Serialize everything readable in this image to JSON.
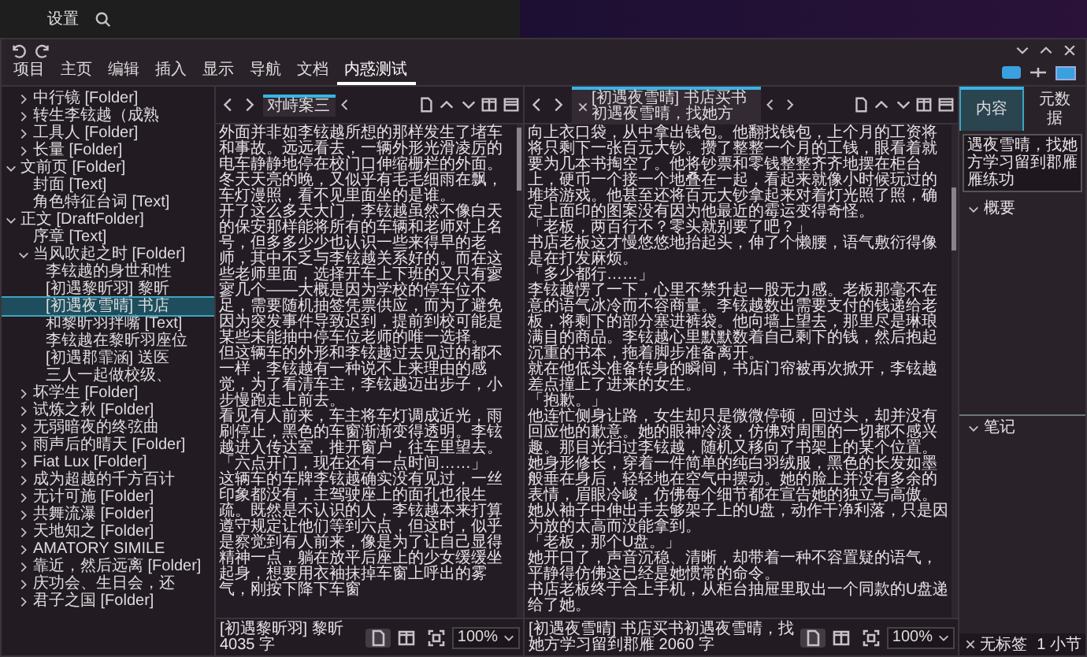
{
  "background_window": {
    "title": "设置"
  },
  "menu_tabs": [
    {
      "label": "项目",
      "selected": false
    },
    {
      "label": "主页",
      "selected": false
    },
    {
      "label": "编辑",
      "selected": false
    },
    {
      "label": "插入",
      "selected": false
    },
    {
      "label": "显示",
      "selected": false
    },
    {
      "label": "导航",
      "selected": false
    },
    {
      "label": "文档",
      "selected": false
    },
    {
      "label": "内惑测试",
      "selected": true
    }
  ],
  "binder": {
    "scrolled_parent_children": [
      {
        "label": "中行镜 [Folder]",
        "selected": false,
        "expanded": false
      },
      {
        "label": "转生李铉越（成熟",
        "selected": false,
        "expanded": false
      },
      {
        "label": "工具人 [Folder]",
        "selected": false,
        "expanded": false
      },
      {
        "label": "长量 [Folder]",
        "selected": false,
        "expanded": false
      }
    ],
    "items": [
      {
        "label": "文前页 [Folder]",
        "selected": false,
        "expanded": true,
        "children": [
          {
            "label": "封面 [Text]",
            "selected": false
          },
          {
            "label": "角色特征台词 [Text]",
            "selected": false
          }
        ]
      },
      {
        "label": "正文 [DraftFolder]",
        "selected": false,
        "expanded": true,
        "children": [
          {
            "label": "序章 [Text]",
            "selected": false
          },
          {
            "label": "当风吹起之时 [Folder]",
            "selected": false,
            "expanded": true,
            "children": [
              {
                "label": "李铉越的身世和性",
                "selected": false
              },
              {
                "label": "[初遇黎昕羽] 黎昕",
                "selected": false
              },
              {
                "label": "[初遇夜雪晴] 书店",
                "selected": true
              },
              {
                "label": "和黎昕羽拌嘴 [Text]",
                "selected": false
              },
              {
                "label": "李铉越在黎昕羽座位",
                "selected": false
              },
              {
                "label": "[初遇郡霏涵] 送医",
                "selected": false
              },
              {
                "label": "三人一起做校级、",
                "selected": false
              }
            ]
          },
          {
            "label": "坏学生 [Folder]",
            "selected": false,
            "expanded": false
          },
          {
            "label": "试炼之秋 [Folder]",
            "selected": false,
            "expanded": false
          },
          {
            "label": "无弱暗夜的终弦曲",
            "selected": false,
            "expanded": false
          },
          {
            "label": "雨声后的晴天 [Folder]",
            "selected": false,
            "expanded": false
          },
          {
            "label": "Fiat Lux [Folder]",
            "selected": false,
            "expanded": false
          },
          {
            "label": "成为超越的千方百计",
            "selected": false,
            "expanded": false
          },
          {
            "label": "无计可施 [Folder]",
            "selected": false,
            "expanded": false
          },
          {
            "label": "共舞流瀑 [Folder]",
            "selected": false,
            "expanded": false
          },
          {
            "label": "天地知之 [Folder]",
            "selected": false,
            "expanded": false
          },
          {
            "label": "AMATORY SIMILE",
            "selected": false,
            "expanded": false
          },
          {
            "label": "靠近，然后远离 [Folder]",
            "selected": false,
            "expanded": false
          },
          {
            "label": "庆功会、生日会，还",
            "selected": false,
            "expanded": false
          },
          {
            "label": "君子之国 [Folder]",
            "selected": false,
            "expanded": false
          }
        ]
      }
    ]
  },
  "editors": [
    {
      "tab": {
        "label": "对峙案三",
        "closable": false
      },
      "paragraphs": [
        "外面并非如李铉越所想的那样发生了堵车和事故。远远看去，一辆外形光滑凌厉的电车静静地停在校门口伸缩栅栏的外面。冬天天亮的晚，又似乎有毛毛细雨在飘，车灯漫照，看不见里面坐的是谁。",
        "开了这么多天大门，李铉越虽然不像白天的保安那样能将所有的车辆和老师对上名号，但多多少少也认识一些来得早的老师，其中不乏与李铉越关系好的。而在这些老师里面，选择开车上下班的又只有寥寥几个——大概是因为学校的停车位不足，需要随机抽签凭票供应，而为了避免因为突发事件导致迟到，提前到校可能是某些未能抽中停车位老师的唯一选择。",
        "但这辆车的外形和李铉越过去见过的都不一样，李铉越有一种说不上来理由的感觉，为了看清车主，李铉越迈出步子，小步慢跑走上前去。",
        "看见有人前来，车主将车灯调成近光，雨刷停止，黑色的车窗渐渐变得透明。李铉越进入传达室，推开窗户，往车里望去。",
        "「六点开门，现在还有一点时间……」",
        "这辆车的车牌李铉越确实没有见过，一丝印象都没有，主驾驶座上的面孔也很生疏。既然是不认识的人，李铉越本来打算遵守规定让他们等到六点，但这时，似乎是察觉到有人前来，像是为了让自己显得精神一点，躺在放平后座上的少女缓缓坐起身，想要用衣袖抹掉车窗上呼出的雾气，刚按下降下车窗"
      ],
      "status": "[初遇黎昕羽] 黎昕 4035 字",
      "zoom": "100%"
    },
    {
      "tab": {
        "label": "[初遇夜雪晴] 书店买书初遇夜雪晴，找她方",
        "closable": true
      },
      "paragraphs": [
        "向上衣口袋，从中拿出钱包。他翻找钱包，上个月的工资将将只剩下一张百元大钞。攒了整整一个月的工钱，眼看着就要为几本书掏空了。他将钞票和零钱整整齐齐地摆在柜台上，硬币一个接一个地叠在一起，看起来就像小时候玩过的堆塔游戏。他甚至还将百元大钞拿起来对着灯光照了照，确定上面印的图案没有因为他最近的霉运变得奇怪。",
        "「老板，两百行不？零头就别要了吧？」",
        "书店老板这才慢悠悠地抬起头，伸了个懒腰，语气敷衍得像是在打发麻烦。",
        "「多少都行……」",
        "李铉越愣了一下，心里不禁升起一股无力感。老板那毫不在意的语气冰冷而不容商量。李铉越数出需要支付的钱递给老板，将剩下的部分塞进裤袋。他向墙上望去，那里尽是琳琅满目的商品。李铉越心里默默数着自己剩下的钱，然后抱起沉重的书本，拖着脚步准备离开。",
        "就在他低头准备转身的瞬间，书店门帘被再次掀开，李铉越差点撞上了进来的女生。",
        "「抱歉。」",
        "他连忙侧身让路，女生却只是微微停顿，回过头，却并没有回应他的歉意。她的眼神冷淡，仿佛对周围的一切都不感兴趣。那目光扫过李铉越，随机又移向了书架上的某个位置。",
        "她身形修长，穿着一件简单的纯白羽绒服，黑色的长发如墨般垂在身后，轻轻地在空气中摆动。她的脸上并没有多余的表情，眉眼冷峻，仿佛每个细节都在宣告她的独立与高傲。她从袖子中伸出手去够架子上的U盘，动作干净利落，只是因为放的太高而没能拿到。",
        "「老板，那个U盘。」",
        "她开口了，声音沉稳、清晰，却带着一种不容置疑的语气，平静得仿佛这已经是她惯常的命令。",
        "书店老板终于合上手机，从柜台抽屉里取出一个同款的U盘递给了她。"
      ],
      "status": "[初遇夜雪晴] 书店买书初遇夜雪晴，找她方学习留到郡雁 2060 字",
      "zoom": "100%"
    }
  ],
  "inspector": {
    "tabs": [
      {
        "label": "内容",
        "selected": true
      },
      {
        "label": "元数据",
        "selected": false
      }
    ],
    "title": "遇夜雪晴，找她方学习留到郡雁雁练功",
    "sections": [
      {
        "label": "概要",
        "expanded": true
      },
      {
        "label": "笔记",
        "expanded": true
      }
    ],
    "tags": "无标签",
    "count": "1 小节"
  }
}
